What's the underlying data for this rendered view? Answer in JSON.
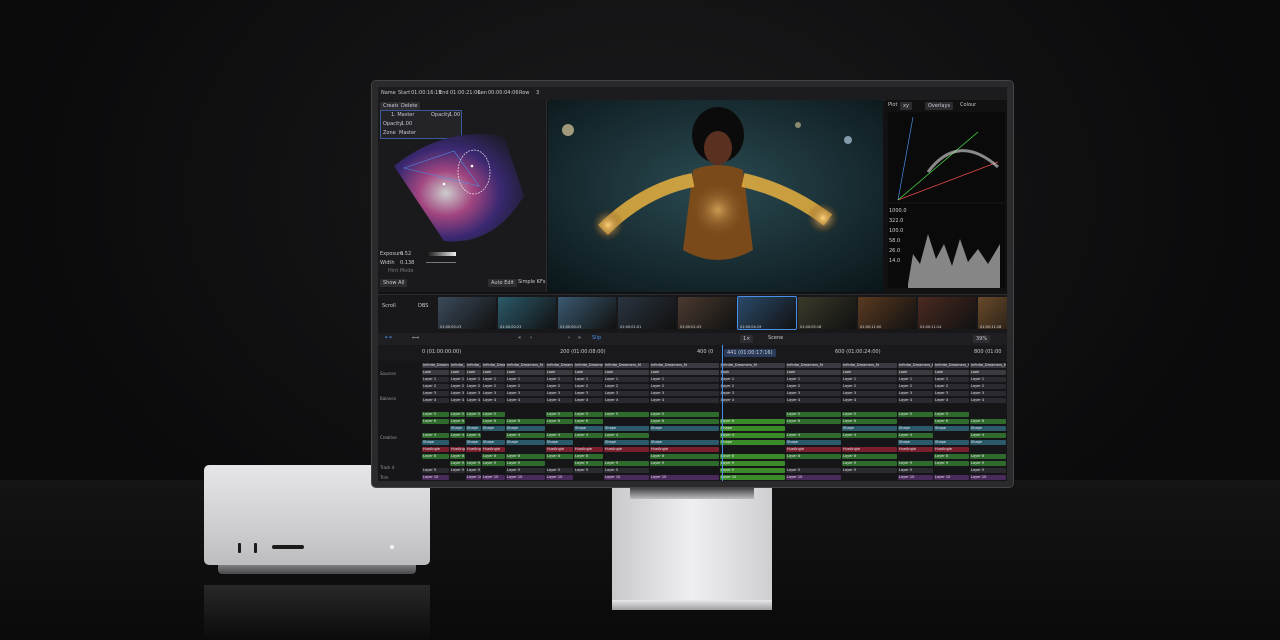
{
  "topbar": {
    "name_label": "Name",
    "start_label": "Start",
    "start_value": "01:00:16:19",
    "end_label": "End",
    "end_value": "01:00:21:00",
    "len_label": "Len",
    "len_value": "00:00:04:06",
    "row_label": "Row",
    "row_value": "3",
    "create_btn": "Create",
    "delete_btn": "Delete"
  },
  "leftpanel": {
    "layer_name": "1. Master",
    "opacity_label": "Opacity",
    "opacity_value": "1.00",
    "opacity_field": "1.00",
    "zone_label": "Zone",
    "zone_value": "Master",
    "exposure_label": "Exposure",
    "exposure_value": "0.52",
    "width_label": "Width",
    "width_value": "0.138",
    "show_all": "Show All",
    "auto_edit": "Auto Edit",
    "simple_kfs": "Simple KFs",
    "hint": "Hint Mode"
  },
  "scopes": {
    "plot_label": "Plot",
    "plot_value": "xy",
    "overlays": "Overlays",
    "colour": "Colour",
    "wave_ticks": [
      "1000.0",
      "322.0",
      "100.0",
      "58.0",
      "26.0",
      "14.0"
    ]
  },
  "thumbs": {
    "scroll_label": "Scroll",
    "dbs_label": "DBS",
    "dbs_value": "0",
    "timecodes": [
      "01:00:00:23",
      "01:00:00:23",
      "01:00:00:23",
      "01:00:01:01",
      "01:00:01:03",
      "01:00:04:19",
      "01:00:05:18",
      "01:00:11:00",
      "01:00:11:14",
      "01:00:11:28",
      "01:00:11"
    ]
  },
  "toolbar": {
    "slip": "Slip",
    "speed": "1×",
    "scene": "Scene",
    "zoom": "39%"
  },
  "ruler": {
    "ticks": [
      "0 (01:00:00:00)",
      "200 (01:00:08:00)",
      "400 (0",
      "600 (01:00:24:00)",
      "800 (01:00"
    ],
    "current": "441 (01:00:17:16)"
  },
  "tracks": [
    "Sources",
    "Balance",
    "Creative",
    "Track 4",
    "Trim"
  ],
  "clips": {
    "look": "Look",
    "transform": "Transform",
    "shape": "Shape",
    "hueangle": "HueAngle",
    "reference": "Reference",
    "infinite": "Infinite_Dreamers_M",
    "layers": [
      "Layer 1",
      "Layer 2",
      "Layer 3",
      "Layer 4",
      "Layer 5",
      "Layer 6",
      "Layer 7",
      "Layer 8",
      "Layer 9",
      "Layer 10"
    ]
  },
  "colors": {
    "accent": "#4a8fe8",
    "clip_green": "#2f6b2c",
    "clip_teal": "#2b5b6b",
    "clip_red": "#7a1f2e",
    "clip_grey": "#3a3a40"
  }
}
